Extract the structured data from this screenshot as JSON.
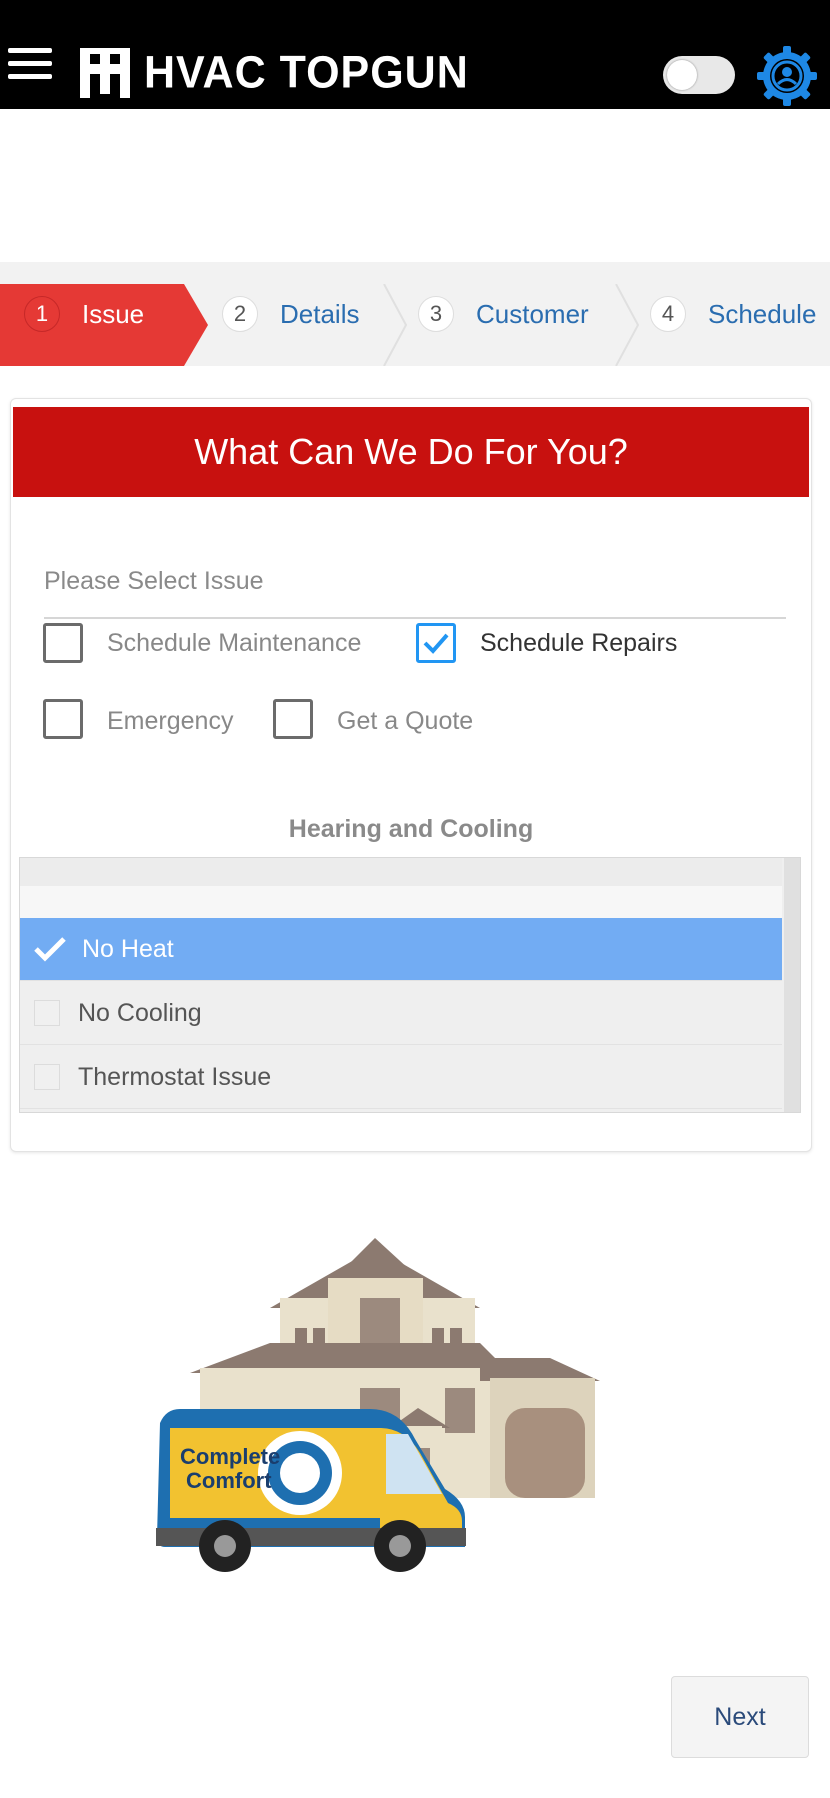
{
  "header": {
    "brand": "HVAC TOPGUN",
    "theme_toggle": "off"
  },
  "stepper": {
    "steps": [
      {
        "number": "1",
        "label": "Issue",
        "state": "active"
      },
      {
        "number": "2",
        "label": "Details",
        "state": "inactive"
      },
      {
        "number": "3",
        "label": "Customer",
        "state": "inactive"
      },
      {
        "number": "4",
        "label": "Schedule",
        "state": "inactive"
      }
    ]
  },
  "card": {
    "title": "What Can We Do For You?",
    "select_label": "Please Select Issue",
    "issues": [
      {
        "label": "Schedule Maintenance",
        "checked": false
      },
      {
        "label": "Schedule Repairs",
        "checked": true
      },
      {
        "label": "Emergency",
        "checked": false
      },
      {
        "label": "Get a Quote",
        "checked": false
      }
    ],
    "section_title": "Hearing and Cooling",
    "options": [
      {
        "label": "No Heat",
        "selected": true
      },
      {
        "label": "No Cooling",
        "selected": false
      },
      {
        "label": "Thermostat Issue",
        "selected": false
      }
    ]
  },
  "illustration": {
    "van_brand_line1": "Complete",
    "van_brand_line2": "Comfort"
  },
  "footer": {
    "next_label": "Next"
  },
  "colors": {
    "accent_red": "#c8110f",
    "step_active": "#e53935",
    "link_blue": "#2a6db0",
    "selected_blue": "#72acf3",
    "check_blue": "#2196f3",
    "gear_blue": "#1e88e5"
  }
}
